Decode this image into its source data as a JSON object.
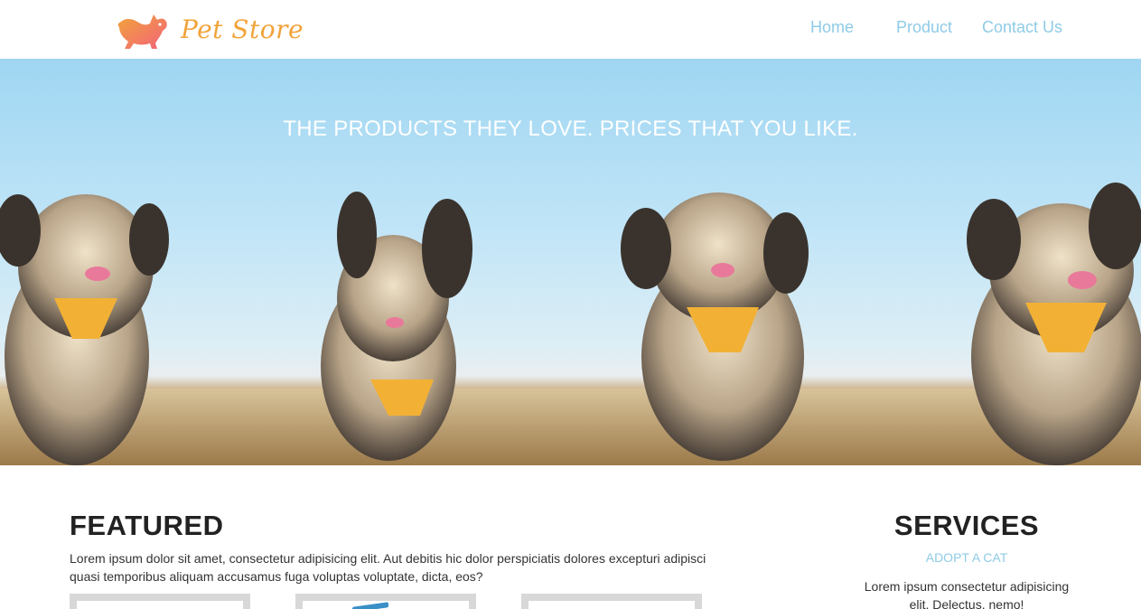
{
  "header": {
    "logo_text": "Pet Store",
    "nav": [
      {
        "label": "Home"
      },
      {
        "label": "Product"
      },
      {
        "label": "Contact Us"
      }
    ]
  },
  "hero": {
    "tagline": "THE PRODUCTS THEY LOVE. PRICES THAT YOU LIKE."
  },
  "featured": {
    "title": "FEATURED",
    "text": "Lorem ipsum dolor sit amet, consectetur adipisicing elit. Aut debitis hic dolor perspiciatis dolores excepturi adipisci quasi temporibus aliquam accusamus fuga voluptas voluptate, dicta, eos?"
  },
  "services": {
    "title": "SERVICES",
    "link": "ADOPT A CAT",
    "text": "Lorem ipsum consectetur adipisicing elit. Delectus, nemo!"
  },
  "colors": {
    "accent": "#8fcbe6",
    "logo_orange": "#f2a33a",
    "logo_pink": "#f27a6a"
  }
}
